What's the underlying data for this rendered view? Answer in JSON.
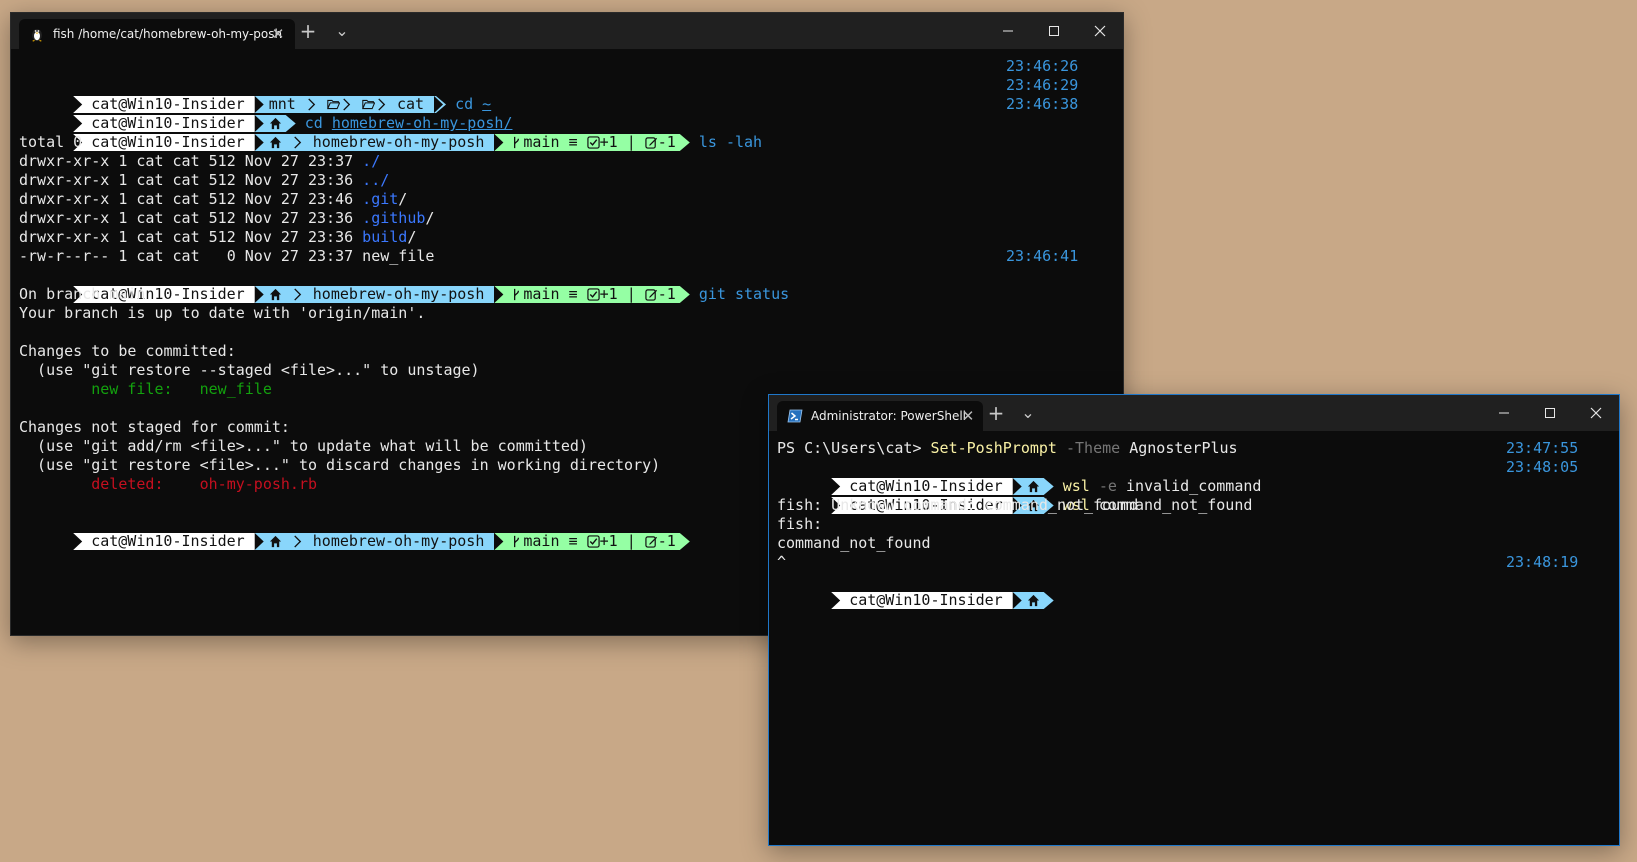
{
  "window1": {
    "tab_title": "fish /home/cat/homebrew-oh-my-posh",
    "tab_icon": "linux-tux-icon",
    "close_glyph": "✕",
    "new_tab_glyph": "+",
    "dropdown_glyph": "⌄",
    "prompts": {
      "p1": {
        "user": "cat@Win10-Insider",
        "path": [
          "mnt",
          "",
          "cat"
        ],
        "command": "cd",
        "arg": "~"
      },
      "p2": {
        "user": "cat@Win10-Insider",
        "command": "cd",
        "arg": "homebrew-oh-my-posh/"
      },
      "p3": {
        "user": "cat@Win10-Insider",
        "path": "homebrew-oh-my-posh",
        "git_branch": "main ≡",
        "git_staged": "+1",
        "git_bar": "|",
        "git_modified": "-1",
        "command": "ls",
        "arg": "-lah"
      },
      "p4": {
        "user": "cat@Win10-Insider",
        "path": "homebrew-oh-my-posh",
        "git_branch": "main ≡",
        "git_staged": "+1",
        "git_bar": "|",
        "git_modified": "-1",
        "command": "git",
        "arg": "status"
      },
      "p5": {
        "user": "cat@Win10-Insider",
        "path": "homebrew-oh-my-posh",
        "git_branch": "main ≡",
        "git_staged": "+1",
        "git_bar": "|",
        "git_modified": "-1"
      }
    },
    "ls": {
      "total": "total 0",
      "rows": [
        {
          "meta": "drwxr-xr-x 1 cat cat 512 Nov 27 23:37 ",
          "name": "./"
        },
        {
          "meta": "drwxr-xr-x 1 cat cat 512 Nov 27 23:36 ",
          "name": "../"
        },
        {
          "meta": "drwxr-xr-x 1 cat cat 512 Nov 27 23:46 ",
          "name": ".git",
          "suffix": "/"
        },
        {
          "meta": "drwxr-xr-x 1 cat cat 512 Nov 27 23:36 ",
          "name": ".github",
          "suffix": "/"
        },
        {
          "meta": "drwxr-xr-x 1 cat cat 512 Nov 27 23:36 ",
          "name": "build",
          "suffix": "/"
        },
        {
          "meta": "-rw-r--r-- 1 cat cat   0 Nov 27 23:37 ",
          "name": "new_file"
        }
      ]
    },
    "git_status": {
      "on_branch": "On branch main",
      "up_to_date": "Your branch is up to date with 'origin/main'.",
      "to_commit": "Changes to be committed:",
      "use_restore_staged": "  (use \"git restore --staged <file>...\" to unstage)",
      "new_file_label": "        new file:   ",
      "new_file_name": "new_file",
      "not_staged": "Changes not staged for commit:",
      "use_add_rm": "  (use \"git add/rm <file>...\" to update what will be committed)",
      "use_restore": "  (use \"git restore <file>...\" to discard changes in working directory)",
      "deleted_label": "        deleted:    ",
      "deleted_name": "oh-my-posh.rb"
    },
    "timestamps": [
      "23:46:26",
      "23:46:29",
      "23:46:38",
      "23:46:41"
    ]
  },
  "window2": {
    "tab_title": "Administrator: PowerShell",
    "tab_icon": "powershell-icon",
    "close_glyph": "✕",
    "new_tab_glyph": "+",
    "dropdown_glyph": "⌄",
    "ps_prompt": "PS C:\\Users\\cat> ",
    "ps_cmd": "Set-PoshPrompt",
    "ps_param": " -Theme",
    "ps_value": " AgnosterPlus",
    "prompts": {
      "q1": {
        "user": "cat@Win10-Insider",
        "command": "wsl",
        "flag": " -e",
        "arg": " invalid_command"
      },
      "q2": {
        "user": "cat@Win10-Insider",
        "command": "wsl",
        "arg": " command_not_found"
      },
      "q3": {
        "user": "cat@Win10-Insider"
      }
    },
    "output": [
      "fish: Unknown command: command_not_found",
      "fish:",
      "command_not_found",
      "^"
    ],
    "timestamps": [
      "23:47:55",
      "23:48:05",
      "23:48:19"
    ]
  },
  "colors": {
    "desktop": "#c8a887",
    "terminal_bg": "#0c0c0c",
    "user_segment": "#ffffff",
    "path_segment": "#89d6fb",
    "git_segment": "#95ffa4",
    "timestamp": "#3a96dd"
  }
}
